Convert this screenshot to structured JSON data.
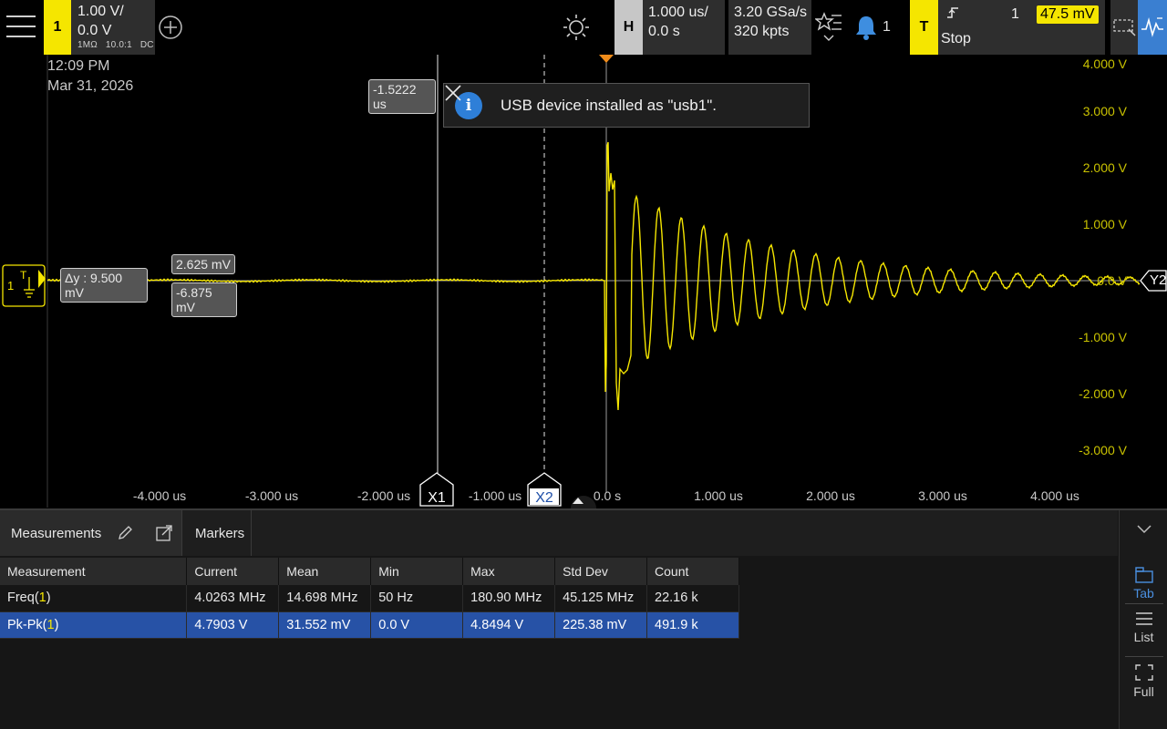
{
  "topbar": {
    "ch1": {
      "label": "1",
      "scale": "1.00 V/",
      "offset": "0.0 V",
      "impedance": "1MΩ",
      "probe": "10.0:1",
      "coupling": "DC",
      "color": "#f5e600"
    },
    "horizontal": {
      "label": "H",
      "timebase": "1.000 us/",
      "position": "0.0 s"
    },
    "acquisition": {
      "sample_rate": "3.20 GSa/s",
      "memory_depth": "320 kpts"
    },
    "notifications": {
      "count": "1"
    },
    "trigger": {
      "label": "T",
      "source": "1",
      "level": "47.5 mV",
      "state": "Stop"
    }
  },
  "scope": {
    "date": "Mar 31, 2026",
    "time": "12:09 PM",
    "y_ticks": [
      "4.000 V",
      "3.000 V",
      "2.000 V",
      "1.000 V",
      "0.0 V",
      "-1.000 V",
      "-2.000 V",
      "-3.000 V"
    ],
    "x_ticks": [
      "-4.000 us",
      "-3.000 us",
      "-2.000 us",
      "-1.000 us",
      "0.0 s",
      "1.000 us",
      "2.000 us",
      "3.000 us",
      "4.000 us"
    ],
    "cursor_delta_y": "Δy : 9.500 mV",
    "cursor_y1": "2.625 mV",
    "cursor_y2": "-6.875 mV",
    "cursor_x1_value": "-1.5222 us",
    "x1_label": "X1",
    "x2_label": "X2",
    "y2_label": "Y2",
    "ch1_marker": "1",
    "trigger_marker": "T"
  },
  "toast": {
    "message": "USB device installed as \"usb1\"."
  },
  "panel": {
    "tabs": [
      "Measurements",
      "Markers"
    ],
    "columns": [
      "Measurement",
      "Current",
      "Mean",
      "Min",
      "Max",
      "Std Dev",
      "Count"
    ],
    "rows": [
      {
        "name": "Freq(",
        "ch": "1",
        "close": ")",
        "current": "4.0263 MHz",
        "mean": "14.698 MHz",
        "min": "50 Hz",
        "max": "180.90 MHz",
        "std": "45.125 MHz",
        "count": "22.16 k"
      },
      {
        "name": "Pk-Pk(",
        "ch": "1",
        "close": ")",
        "current": "4.7903 V",
        "mean": "31.552 mV",
        "min": "0.0 V",
        "max": "4.8494 V",
        "std": "225.38 mV",
        "count": "491.9 k"
      }
    ],
    "side": {
      "tab": "Tab",
      "list": "List",
      "full": "Full"
    }
  }
}
